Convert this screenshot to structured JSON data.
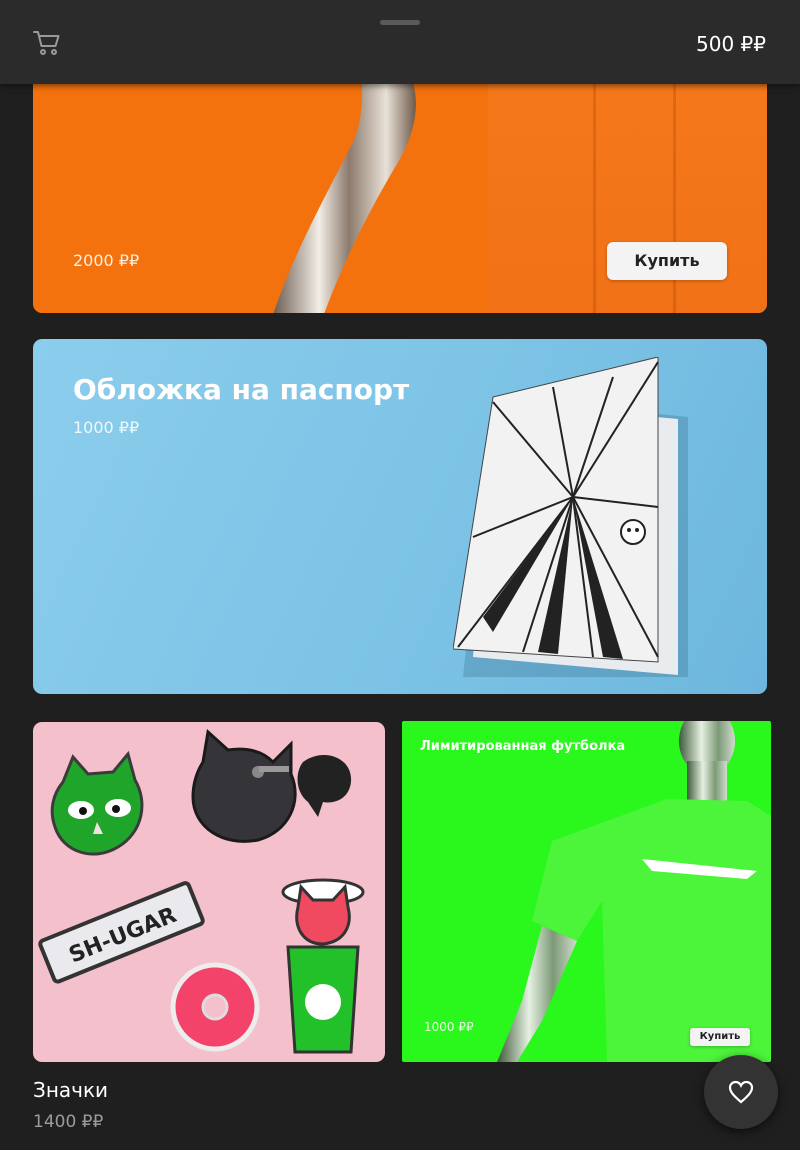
{
  "header": {
    "balance": "500 ₽₽",
    "cart_icon": "cart-icon"
  },
  "cards": [
    {
      "price": "2000 ₽₽",
      "buy_label": "Купить",
      "accent": "#f4720d"
    },
    {
      "title": "Обложка на паспорт",
      "price": "1000 ₽₽",
      "accent": "#7cc3e6"
    },
    {
      "title": "Значки",
      "price": "1400 ₽₽",
      "accent": "#f4c0cb",
      "image_text": "SH-UGAR"
    },
    {
      "label": "Лимитированная футболка",
      "price": "1000 ₽₽",
      "buy_label": "Купить",
      "accent": "#2af71c"
    }
  ],
  "fab": {
    "icon": "heart-icon"
  }
}
